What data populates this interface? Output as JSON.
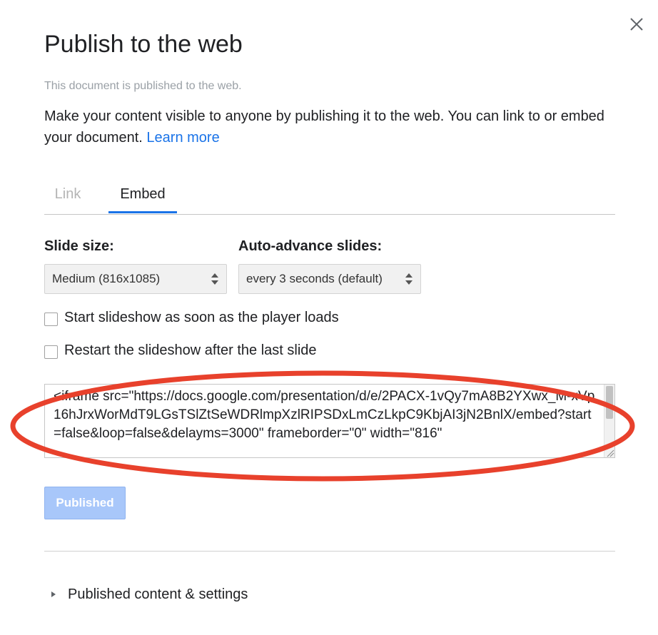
{
  "dialog": {
    "title": "Publish to the web",
    "status": "This document is published to the web.",
    "description": "Make your content visible to anyone by publishing it to the web. You can link to or embed your document.",
    "learn_more": "Learn more"
  },
  "tabs": [
    {
      "label": "Link",
      "active": false
    },
    {
      "label": "Embed",
      "active": true
    }
  ],
  "slide_size": {
    "label": "Slide size:",
    "value": "Medium (816x1085)"
  },
  "auto_advance": {
    "label": "Auto-advance slides:",
    "value": "every 3 seconds (default)"
  },
  "options": [
    {
      "label": "Start slideshow as soon as the player loads",
      "checked": false
    },
    {
      "label": "Restart the slideshow after the last slide",
      "checked": false
    }
  ],
  "embed_code": "<iframe src=\"https://docs.google.com/presentation/d/e/2PACX-1vQy7mA8B2YXwx_M-xVp16hJrxWorMdT9LGsTSlZtSeWDRlmpXzlRIPSDxLmCzLkpC9KbjAI3jN2BnlX/embed?start=false&loop=false&delayms=3000\" frameborder=\"0\" width=\"816\"",
  "published_button": "Published",
  "published_settings": "Published content & settings",
  "colors": {
    "accent": "#1a73e8",
    "highlight_oval": "#e8412c",
    "published_button": "#a8c7fa"
  },
  "icons": {
    "close": "close-icon",
    "select_arrows": "updown-arrows-icon",
    "expand": "caret-right-icon",
    "resize": "resize-grip-icon"
  }
}
